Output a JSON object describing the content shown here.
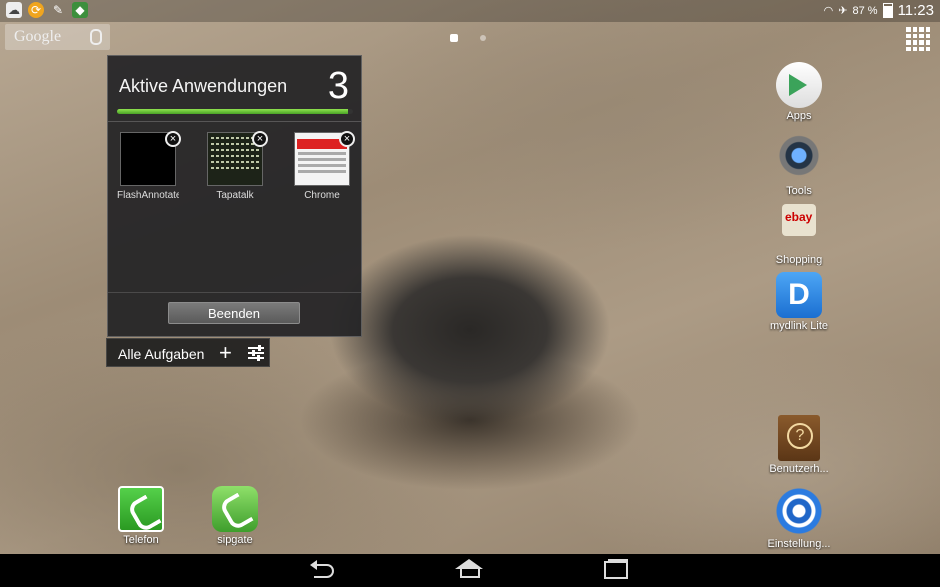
{
  "status_bar": {
    "notification_icons": [
      "cloud-icon",
      "sync-icon",
      "pen-icon",
      "app-badge-icon"
    ],
    "battery_percent": "87 %",
    "battery_level": 0.87,
    "time": "11:23"
  },
  "search_widget": {
    "label": "Google"
  },
  "page_indicator": {
    "pages": 2,
    "current": 1
  },
  "task_manager": {
    "title": "Aktive Anwendungen",
    "count": "3",
    "progress_fraction": 0.98,
    "apps": [
      {
        "label": "FlashAnnotate"
      },
      {
        "label": "Tapatalk"
      },
      {
        "label": "Chrome"
      }
    ],
    "end_button": "Beenden",
    "footer_label": "Alle Aufgaben"
  },
  "right_shortcuts": [
    {
      "label": "Apps",
      "icon": "play-store-icon"
    },
    {
      "label": "Tools",
      "icon": "camera-icon"
    },
    {
      "label": "Shopping",
      "icon": "ebay-icon"
    },
    {
      "label": "mydlink Lite",
      "icon": "dlink-icon"
    },
    {
      "label": "Benutzerh...",
      "icon": "help-book-icon"
    },
    {
      "label": "Einstellung...",
      "icon": "settings-gear-icon"
    }
  ],
  "dock": [
    {
      "label": "Telefon",
      "icon": "phone-icon"
    },
    {
      "label": "sipgate",
      "icon": "sipgate-icon"
    }
  ],
  "colors": {
    "progress_green": "#6ac93a",
    "accent_blue": "#2b7be0"
  }
}
